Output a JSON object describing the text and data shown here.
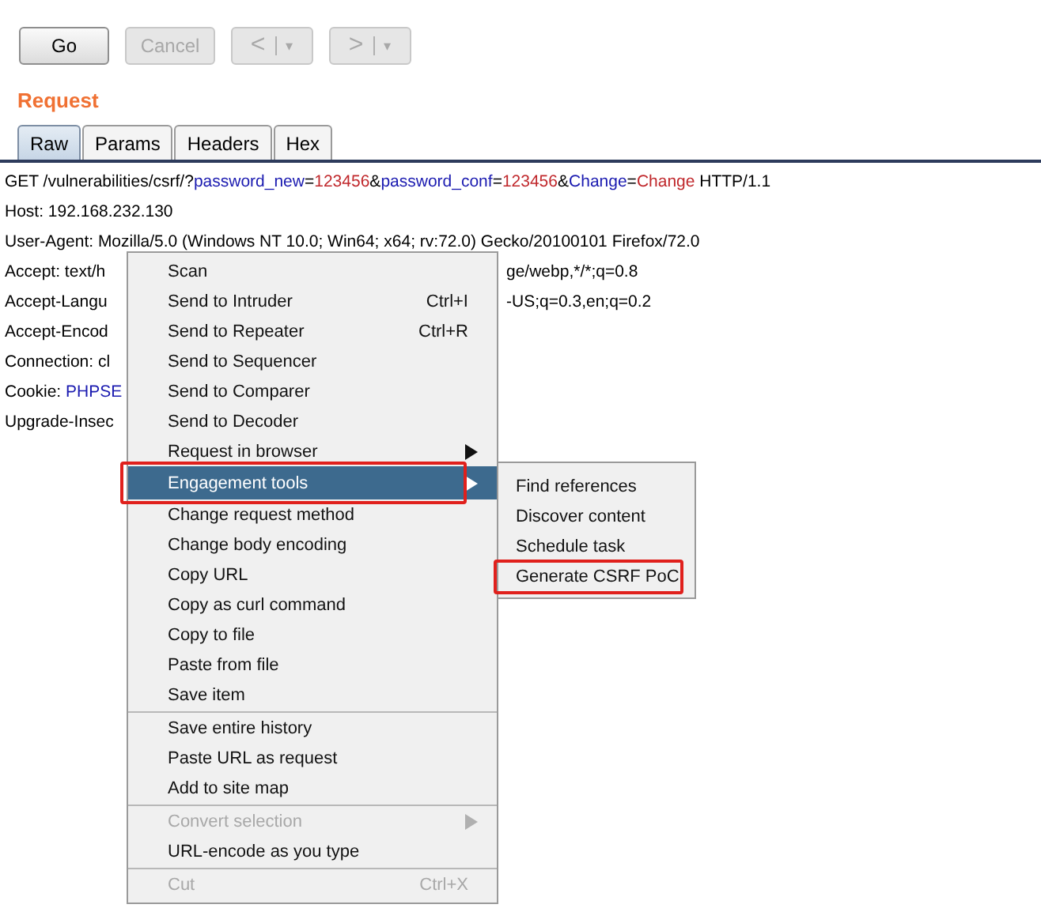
{
  "toolbar": {
    "buttons": [
      {
        "kind": "text",
        "label": "Go",
        "disabled": false
      },
      {
        "kind": "text",
        "label": "Cancel",
        "disabled": true
      },
      {
        "kind": "nav",
        "label": "<",
        "dropdown": "▾",
        "disabled": true
      },
      {
        "kind": "nav",
        "label": ">",
        "dropdown": "▾",
        "disabled": true
      }
    ]
  },
  "request": {
    "title": "Request",
    "tabs": [
      {
        "label": "Raw",
        "selected": true
      },
      {
        "label": "Params",
        "selected": false
      },
      {
        "label": "Headers",
        "selected": false
      },
      {
        "label": "Hex",
        "selected": false
      }
    ],
    "lines": [
      {
        "parts": [
          {
            "kind": "plain",
            "text": "GET /vulnerabilities/csrf/?"
          },
          {
            "kind": "name",
            "text": "password_new"
          },
          {
            "kind": "plain",
            "text": "="
          },
          {
            "kind": "value",
            "text": "123456"
          },
          {
            "kind": "plain",
            "text": "&"
          },
          {
            "kind": "name",
            "text": "password_conf"
          },
          {
            "kind": "plain",
            "text": "="
          },
          {
            "kind": "value",
            "text": "123456"
          },
          {
            "kind": "plain",
            "text": "&"
          },
          {
            "kind": "name",
            "text": "Change"
          },
          {
            "kind": "plain",
            "text": "="
          },
          {
            "kind": "value",
            "text": "Change"
          },
          {
            "kind": "plain",
            "text": " HTTP/1.1"
          }
        ]
      },
      {
        "parts": [
          {
            "kind": "plain",
            "text": "Host: 192.168.232.130"
          }
        ]
      },
      {
        "parts": [
          {
            "kind": "plain",
            "text": "User-Agent: Mozilla/5.0 (Windows NT 10.0; Win64; x64; rv:72.0) Gecko/20100101 Firefox/72.0"
          }
        ]
      },
      {
        "parts": [
          {
            "kind": "plain",
            "text": "Accept: text/h"
          }
        ],
        "continued": [
          {
            "kind": "plain",
            "text": "ge/webp,*/*;q=0.8"
          }
        ]
      },
      {
        "parts": [
          {
            "kind": "plain",
            "text": "Accept-Langu"
          }
        ],
        "continued": [
          {
            "kind": "plain",
            "text": "-US;q=0.3,en;q=0.2"
          }
        ]
      },
      {
        "parts": [
          {
            "kind": "plain",
            "text": "Accept-Encod"
          }
        ]
      },
      {
        "parts": [
          {
            "kind": "plain",
            "text": "Connection: cl"
          }
        ]
      },
      {
        "parts": [
          {
            "kind": "plain",
            "text": "Cookie: "
          },
          {
            "kind": "name",
            "text": "PHPSE"
          }
        ]
      },
      {
        "parts": [
          {
            "kind": "plain",
            "text": "Upgrade-Insec"
          }
        ]
      }
    ]
  },
  "context_menu": {
    "items": [
      {
        "kind": "item",
        "label": "Scan",
        "disabled": false,
        "selected": false,
        "annotated": false
      },
      {
        "kind": "item",
        "label": "Send to Intruder",
        "shortcut": "Ctrl+I",
        "disabled": false,
        "selected": false,
        "annotated": false
      },
      {
        "kind": "item",
        "label": "Send to Repeater",
        "shortcut": "Ctrl+R",
        "disabled": false,
        "selected": false,
        "annotated": false
      },
      {
        "kind": "item",
        "label": "Send to Sequencer",
        "disabled": false,
        "selected": false,
        "annotated": false
      },
      {
        "kind": "item",
        "label": "Send to Comparer",
        "disabled": false,
        "selected": false,
        "annotated": false
      },
      {
        "kind": "item",
        "label": "Send to Decoder",
        "disabled": false,
        "selected": false,
        "annotated": false
      },
      {
        "kind": "submenu",
        "label": "Request in browser",
        "disabled": false,
        "selected": false,
        "annotated": false
      },
      {
        "kind": "submenu",
        "label": "Engagement tools",
        "disabled": false,
        "selected": true,
        "annotated": true,
        "children": [
          {
            "label": "Find references",
            "annotated": false
          },
          {
            "label": "Discover content",
            "annotated": false
          },
          {
            "label": "Schedule task",
            "annotated": false
          },
          {
            "label": "Generate CSRF PoC",
            "annotated": true
          }
        ]
      },
      {
        "kind": "item",
        "label": "Change request method",
        "disabled": false,
        "selected": false,
        "annotated": false
      },
      {
        "kind": "item",
        "label": "Change body encoding",
        "disabled": false,
        "selected": false,
        "annotated": false
      },
      {
        "kind": "item",
        "label": "Copy URL",
        "disabled": false,
        "selected": false,
        "annotated": false
      },
      {
        "kind": "item",
        "label": "Copy as curl command",
        "disabled": false,
        "selected": false,
        "annotated": false
      },
      {
        "kind": "item",
        "label": "Copy to file",
        "disabled": false,
        "selected": false,
        "annotated": false
      },
      {
        "kind": "item",
        "label": "Paste from file",
        "disabled": false,
        "selected": false,
        "annotated": false
      },
      {
        "kind": "item",
        "label": "Save item",
        "disabled": false,
        "selected": false,
        "annotated": false
      },
      {
        "kind": "separator"
      },
      {
        "kind": "item",
        "label": "Save entire history",
        "disabled": false,
        "selected": false,
        "annotated": false
      },
      {
        "kind": "item",
        "label": "Paste URL as request",
        "disabled": false,
        "selected": false,
        "annotated": false
      },
      {
        "kind": "item",
        "label": "Add to site map",
        "disabled": false,
        "selected": false,
        "annotated": false
      },
      {
        "kind": "separator"
      },
      {
        "kind": "submenu",
        "label": "Convert selection",
        "disabled": true,
        "selected": false,
        "annotated": false
      },
      {
        "kind": "item",
        "label": "URL-encode as you type",
        "disabled": false,
        "selected": false,
        "annotated": false
      },
      {
        "kind": "separator"
      },
      {
        "kind": "item",
        "label": "Cut",
        "shortcut": "Ctrl+X",
        "disabled": true,
        "selected": false,
        "annotated": false
      }
    ]
  }
}
